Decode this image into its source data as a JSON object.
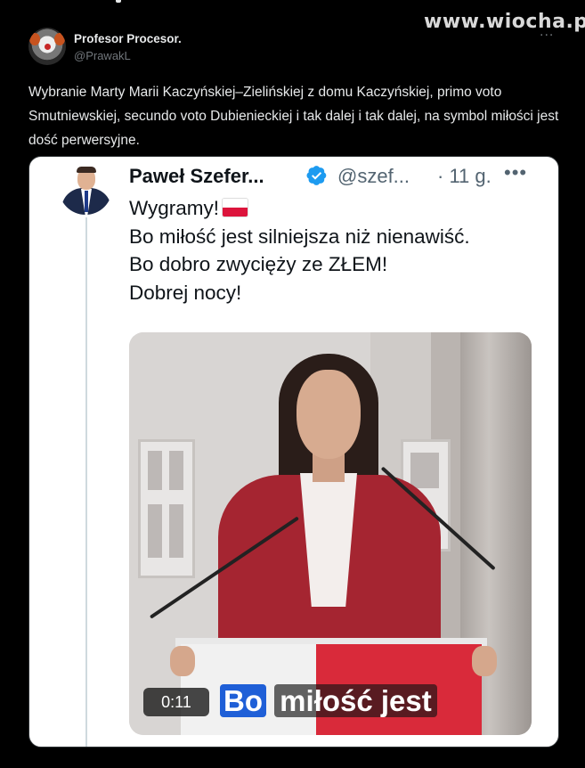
{
  "watermark": "www.wiocha.pl",
  "tweet": {
    "author": "Profesor Procesor.",
    "handle": "@PrawakL",
    "more": "...",
    "text": "Wybranie Marty Marii Kaczyńskiej–Zielińskiej z domu Kaczyńskiej, primo voto Smutniewskiej, secundo voto Dubienieckiej i tak dalej i tak dalej, na symbol miłości jest dość perwersyjne."
  },
  "quoted": {
    "author": "Paweł Szefer...",
    "handle": "@szef...",
    "time": "· 11 g.",
    "more": "•••",
    "lines": [
      "Wygramy!",
      "Bo miłość jest silniejsza niż nienawiść.",
      "Bo dobro zwycięży ze ZŁEM!",
      "Dobrej nocy!"
    ],
    "video": {
      "timer": "0:11",
      "subtitle_highlight": "Bo",
      "subtitle_rest": "miłość jest"
    }
  },
  "colors": {
    "verified": "#1d9bf0",
    "flag_red": "#dc143c",
    "subtitle_highlight": "#1f5fd7"
  }
}
